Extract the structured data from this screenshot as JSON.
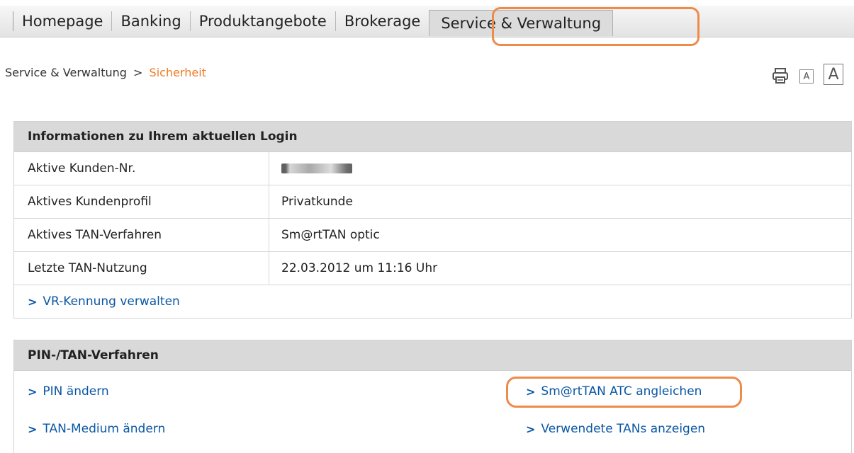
{
  "nav": {
    "tabs": [
      "Homepage",
      "Banking",
      "Produktangebote",
      "Brokerage",
      "Service & Verwaltung"
    ],
    "active_tab": "Service & Verwaltung",
    "highlight_color": "#f08a4b"
  },
  "breadcrumb": {
    "parent": "Service & Verwaltung",
    "separator": ">",
    "current": "Sicherheit",
    "current_color": "#f07a24"
  },
  "tools": {
    "print_icon": "printer-icon",
    "font_small_label": "A",
    "font_large_label": "A"
  },
  "login_info": {
    "title": "Informationen zu Ihrem aktuellen Login",
    "rows": [
      {
        "label": "Aktive Kunden-Nr.",
        "value": "9███████7"
      },
      {
        "label": "Aktives Kundenprofil",
        "value": "Privatkunde"
      },
      {
        "label": "Aktives TAN-Verfahren",
        "value": "Sm@rtTAN optic"
      },
      {
        "label": "Letzte TAN-Nutzung",
        "value": "22.03.2012 um 11:16 Uhr"
      }
    ],
    "link": "VR-Kennung verwalten"
  },
  "pin_tan": {
    "title": "PIN-/TAN-Verfahren",
    "links_left": [
      "PIN ändern",
      "TAN-Medium ändern"
    ],
    "links_right": [
      "Sm@rtTAN ATC angleichen",
      "Verwendete TANs anzeigen"
    ]
  },
  "link_color": "#0b57a4"
}
